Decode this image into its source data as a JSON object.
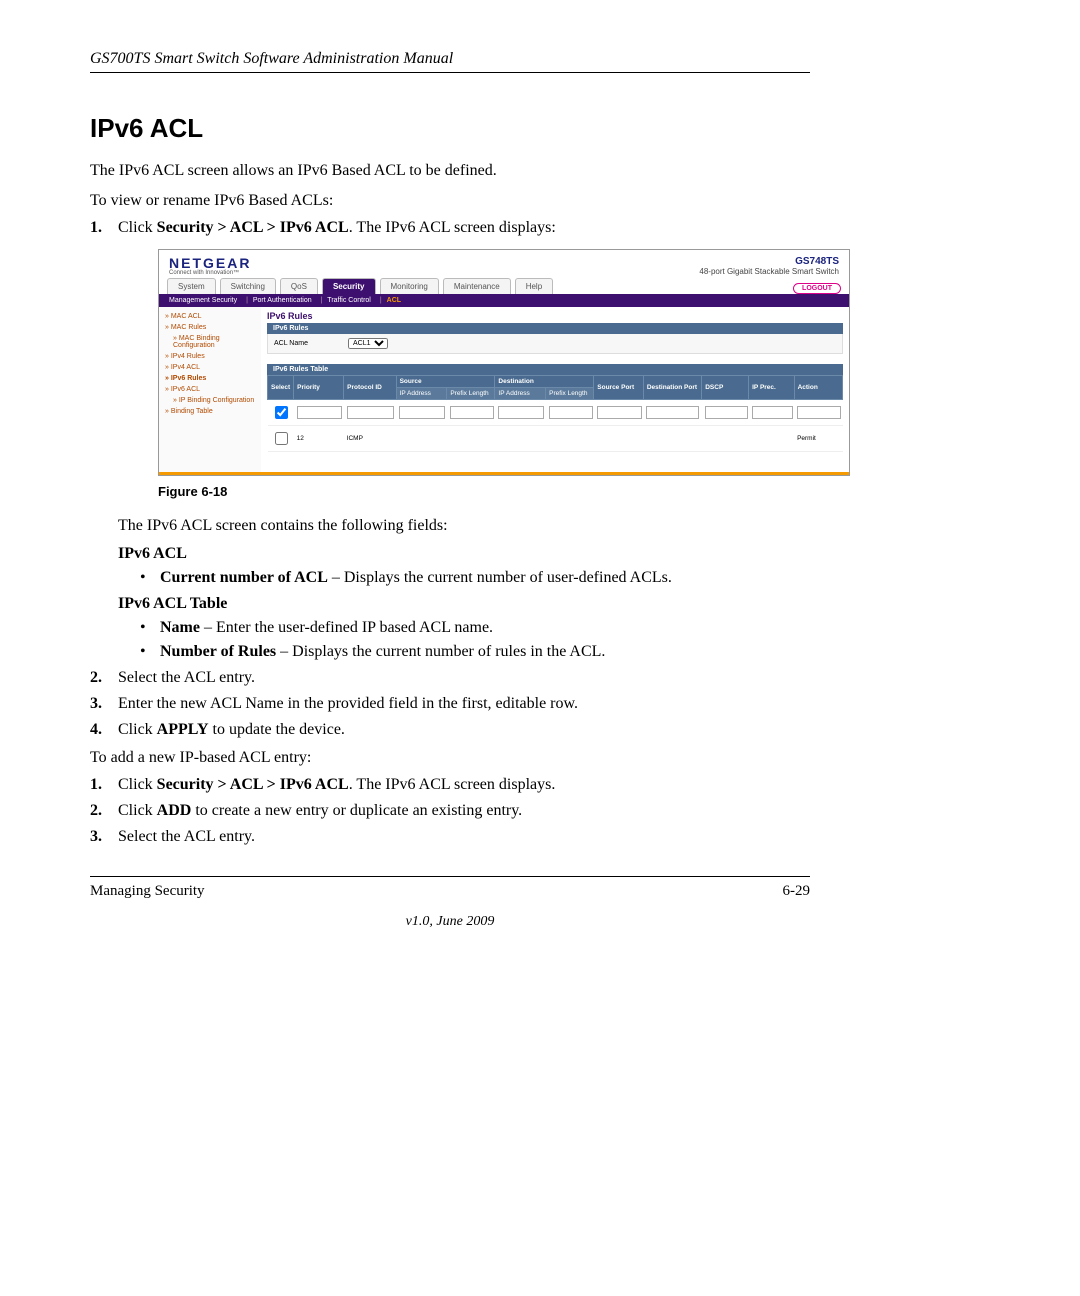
{
  "doc": {
    "header": "GS700TS Smart Switch Software Administration Manual",
    "h1": "IPv6 ACL",
    "intro1": "The IPv6 ACL screen allows an IPv6 Based ACL to be defined.",
    "intro2": "To view or rename IPv6 Based ACLs:",
    "step1_pre": "Click ",
    "step1_b": "Security > ACL > IPv6 ACL",
    "step1_post": ". The IPv6 ACL screen displays:",
    "fig_caption": "Figure 6-18",
    "after_fig": "The IPv6 ACL screen contains the following fields:",
    "subA": "IPv6 ACL",
    "bulA1_b": "Current number of ACL",
    "bulA1_rest": " – Displays the current number of user-defined ACLs.",
    "subB": "IPv6 ACL Table",
    "bulB1_b": "Name",
    "bulB1_rest": " – Enter the user-defined IP based ACL name.",
    "bulB2_b": "Number of Rules",
    "bulB2_rest": " – Displays the current number of rules in the ACL.",
    "step2": "Select the ACL entry.",
    "step3": "Enter the new ACL Name in the provided field in the first, editable row.",
    "step4_pre": "Click ",
    "step4_b": "APPLY",
    "step4_post": " to update the device.",
    "between": "To add a new IP-based ACL entry:",
    "nstep1_pre": "Click ",
    "nstep1_b": "Security > ACL > IPv6 ACL",
    "nstep1_post": ". The IPv6 ACL screen displays.",
    "nstep2_pre": "Click ",
    "nstep2_b": "ADD",
    "nstep2_post": " to create a new entry or duplicate an existing entry.",
    "nstep3": "Select the ACL entry.",
    "footer_left": "Managing Security",
    "footer_right": "6-29",
    "version": "v1.0, June 2009"
  },
  "ss": {
    "logo": "NETGEAR",
    "logo_sub": "Connect with Innovation™",
    "model": "GS748TS",
    "model_sub": "48-port Gigabit Stackable Smart Switch",
    "tabs": [
      "System",
      "Switching",
      "QoS",
      "Security",
      "Monitoring",
      "Maintenance",
      "Help"
    ],
    "active_tab": "Security",
    "logout": "LOGOUT",
    "subnav": [
      "Management Security",
      "Port Authentication",
      "Traffic Control",
      "ACL"
    ],
    "side": [
      "MAC ACL",
      "MAC Rules",
      "MAC Binding Configuration",
      "IPv4 Rules",
      "IPv4 ACL",
      "IPv6 Rules",
      "IPv6 ACL",
      "IP Binding Configuration",
      "Binding Table"
    ],
    "side_highlight": "IPv6 Rules",
    "main_title": "IPv6 Rules",
    "panel1_head": "IPv6 Rules",
    "acl_label": "ACL Name",
    "acl_value": "ACL1",
    "panel2_head": "IPv6 Rules Table",
    "cols_top": [
      "Select",
      "Priority",
      "Protocol ID",
      "Source",
      "Destination",
      "Source Port",
      "Destination Port",
      "DSCP",
      "IP Prec.",
      "Action"
    ],
    "cols_sub": [
      "IP Address",
      "Prefix Length",
      "IP Address",
      "Prefix Length"
    ],
    "row": {
      "priority": "12",
      "protocol": "ICMP",
      "action": "Permit"
    }
  }
}
